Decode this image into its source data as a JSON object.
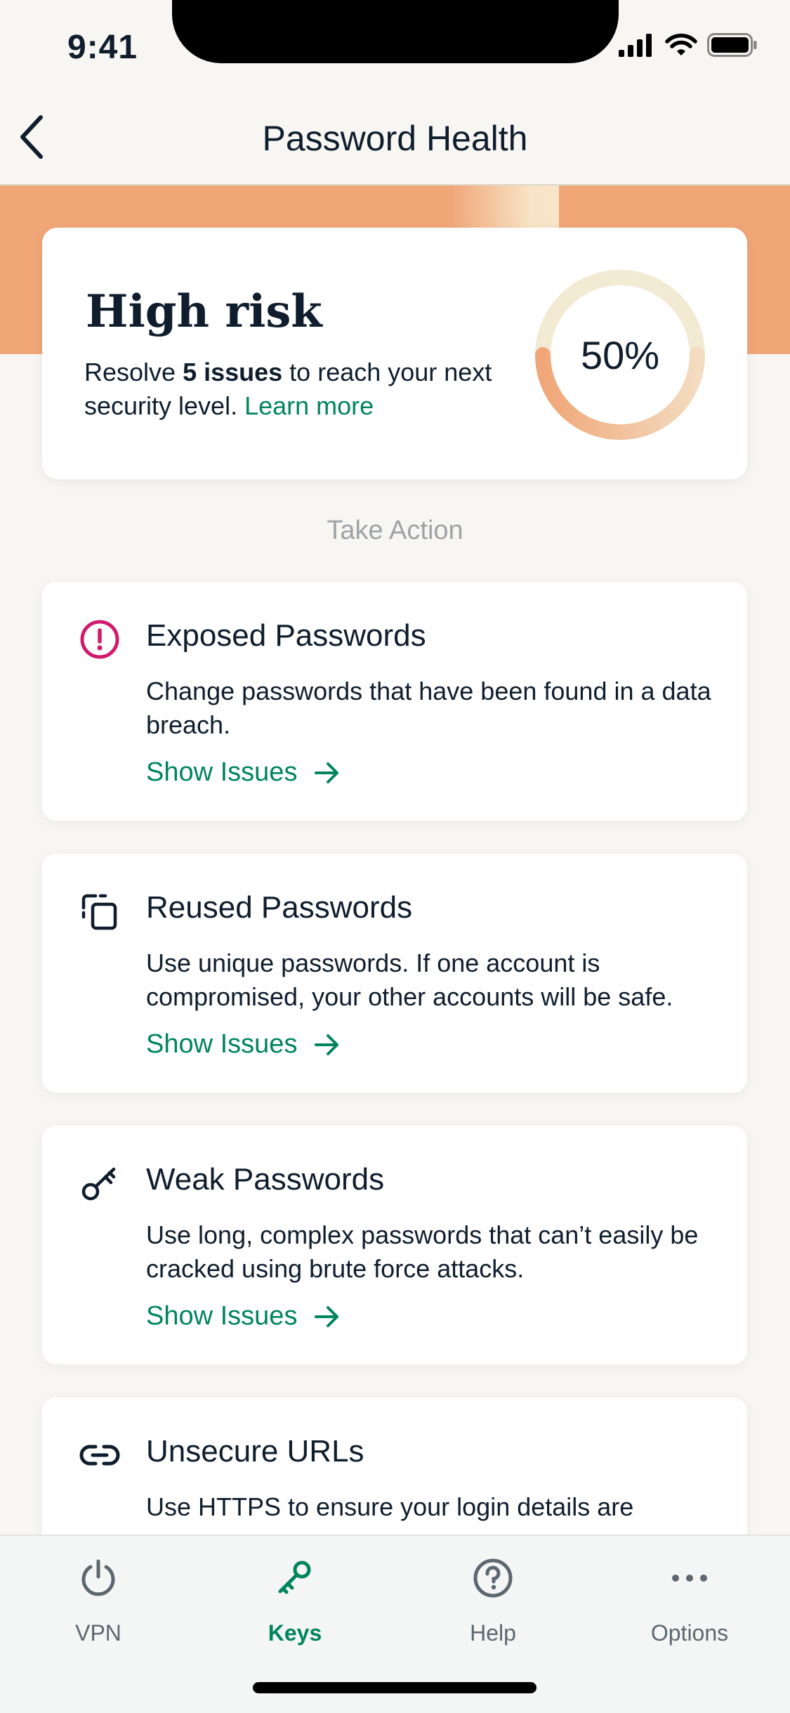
{
  "status_bar": {
    "time": "9:41"
  },
  "nav": {
    "title": "Password Health"
  },
  "risk": {
    "title": "High risk",
    "desc_prefix": "Resolve ",
    "desc_bold": "5 issues",
    "desc_suffix": " to reach your next security level. ",
    "learn_more": "Learn more",
    "percent_label": "50%",
    "progress": 0.5
  },
  "section_label": "Take Action",
  "cards": [
    {
      "title": "Exposed Passwords",
      "desc": "Change passwords that have been found in a data breach.",
      "link": "Show Issues",
      "icon": "alert-circle-icon"
    },
    {
      "title": "Reused Passwords",
      "desc": "Use unique passwords. If one account is compromised, your other accounts will be safe.",
      "link": "Show Issues",
      "icon": "duplicate-icon"
    },
    {
      "title": "Weak Passwords",
      "desc": "Use long, complex passwords that can’t easily be cracked using brute force attacks.",
      "link": "Show Issues",
      "icon": "key-icon"
    },
    {
      "title": "Unsecure URLs",
      "desc": "Use HTTPS to ensure your login details are",
      "icon": "link-icon"
    }
  ],
  "tabs": [
    {
      "label": "VPN",
      "icon": "power-icon",
      "active": false
    },
    {
      "label": "Keys",
      "icon": "key-icon",
      "active": true
    },
    {
      "label": "Help",
      "icon": "help-circle-icon",
      "active": false
    },
    {
      "label": "Options",
      "icon": "more-horizontal-icon",
      "active": false
    }
  ],
  "colors": {
    "accent": "#00855b",
    "banner": "#f0a677",
    "alert": "#d01b6d",
    "text": "#0f1d2d",
    "muted": "#5d6770"
  }
}
